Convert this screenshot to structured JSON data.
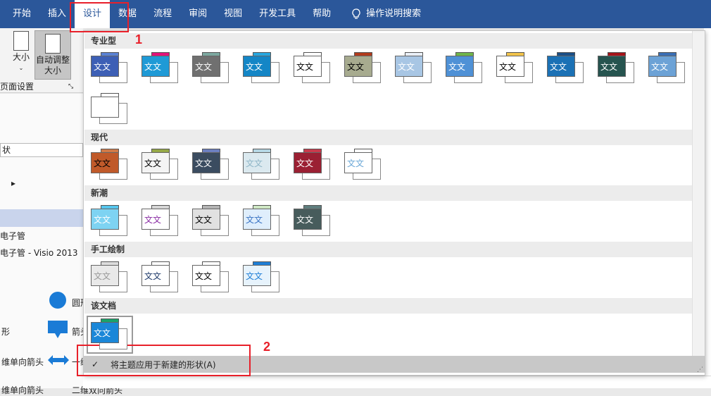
{
  "ribbon": {
    "tabs": [
      "开始",
      "插入",
      "设计",
      "数据",
      "流程",
      "审阅",
      "视图",
      "开发工具",
      "帮助"
    ],
    "active_tab": "设计",
    "search_label": "操作说明搜索",
    "size_label": "大小",
    "autofit_line1": "自动调整",
    "autofit_line2": "大小",
    "page_setup_label": "页面设置"
  },
  "annotations": {
    "label_1": "1",
    "label_2": "2",
    "color": "#e8202a"
  },
  "left_pane": {
    "search_value": "状",
    "item_1": "电子管",
    "item_2": "电子管 - Visio 2013",
    "stencil_1": "圆形",
    "stencil_2": "形",
    "stencil_3": "箭头",
    "stencil_4": "维单向箭头",
    "stencil_5": "一维",
    "stencil_6": "维单向箭头",
    "stencil_7": "二维双向箭头"
  },
  "themes_gallery": {
    "sections": [
      {
        "title": "专业型",
        "count": 13
      },
      {
        "title": "现代",
        "count": 6
      },
      {
        "title": "新潮",
        "count": 5
      },
      {
        "title": "手工绘制",
        "count": 4
      },
      {
        "title": "该文档",
        "count": 1
      }
    ],
    "thumb_text": "文文",
    "apply_to_new_shapes_label": "将主题应用于新建的形状(A)",
    "apply_checked": true,
    "check_glyph": "✓"
  }
}
